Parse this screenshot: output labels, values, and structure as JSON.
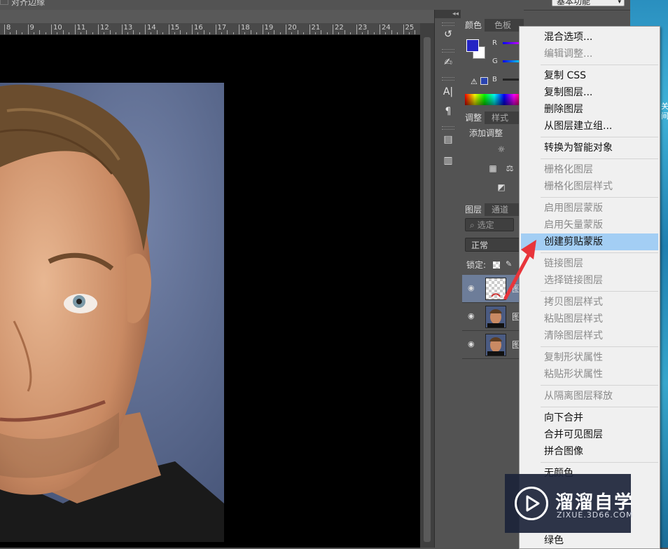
{
  "options_bar": {
    "auto_select_label": "对齐边缘",
    "workspace": "基本功能"
  },
  "ruler": {
    "labels": [
      "8",
      "9",
      "10",
      "11",
      "12",
      "13",
      "14",
      "15",
      "16",
      "17",
      "18",
      "19",
      "20",
      "21",
      "22",
      "23",
      "24",
      "25"
    ]
  },
  "toolstrip": {
    "collapse_glyph": "◂◂"
  },
  "color_panel": {
    "tabs": [
      "颜色",
      "色板"
    ],
    "channels": [
      "R",
      "G",
      "B"
    ],
    "fg_color": "#2424c4",
    "bg_color": "#ffffff"
  },
  "adjust_panel": {
    "tabs": [
      "调整",
      "样式"
    ],
    "add_adjustment": "添加调整"
  },
  "layers_panel": {
    "tabs": [
      "图层",
      "通道"
    ],
    "filter_placeholder": "选定",
    "blend_mode": "正常",
    "lock_label": "锁定:",
    "layers": [
      {
        "name": "图",
        "selected": true,
        "thumb": "transparent"
      },
      {
        "name": "图",
        "selected": false,
        "thumb": "portrait"
      },
      {
        "name": "图",
        "selected": false,
        "thumb": "portrait"
      }
    ]
  },
  "context_menu": {
    "highlight_color": "#a3cef4",
    "items": [
      {
        "label": "混合选项...",
        "disabled": false
      },
      {
        "label": "编辑调整...",
        "disabled": true
      },
      {
        "label": "复制 CSS",
        "disabled": false
      },
      {
        "label": "复制图层...",
        "disabled": false
      },
      {
        "label": "删除图层",
        "disabled": false
      },
      {
        "label": "从图层建立组...",
        "disabled": false
      },
      {
        "label": "转换为智能对象",
        "disabled": false
      },
      {
        "label": "栅格化图层",
        "disabled": true
      },
      {
        "label": "栅格化图层样式",
        "disabled": true
      },
      {
        "label": "启用图层蒙版",
        "disabled": true
      },
      {
        "label": "启用矢量蒙版",
        "disabled": true
      },
      {
        "label": "创建剪贴蒙版",
        "disabled": false,
        "highlighted": true
      },
      {
        "label": "链接图层",
        "disabled": true
      },
      {
        "label": "选择链接图层",
        "disabled": true
      },
      {
        "label": "拷贝图层样式",
        "disabled": true
      },
      {
        "label": "粘贴图层样式",
        "disabled": true
      },
      {
        "label": "清除图层样式",
        "disabled": true
      },
      {
        "label": "复制形状属性",
        "disabled": true
      },
      {
        "label": "粘贴形状属性",
        "disabled": true
      },
      {
        "label": "从隔离图层释放",
        "disabled": true
      },
      {
        "label": "向下合并",
        "disabled": false
      },
      {
        "label": "合并可见图层",
        "disabled": false
      },
      {
        "label": "拼合图像",
        "disabled": false
      },
      {
        "label": "无颜色",
        "disabled": false
      },
      {
        "label": "绿色",
        "disabled": false
      }
    ]
  },
  "watermark": {
    "title": "溜溜自学",
    "subtitle": "ZIXUE.3D66.COM"
  },
  "desktop": {
    "side_text": "关 间"
  }
}
